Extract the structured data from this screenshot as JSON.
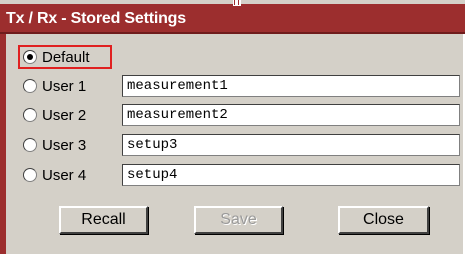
{
  "window": {
    "title": "Tx / Rx - Stored Settings"
  },
  "options": [
    {
      "label": "Default",
      "selected": true
    },
    {
      "label": "User 1",
      "selected": false,
      "value": "measurement1"
    },
    {
      "label": "User 2",
      "selected": false,
      "value": "measurement2"
    },
    {
      "label": "User 3",
      "selected": false,
      "value": "setup3"
    },
    {
      "label": "User 4",
      "selected": false,
      "value": "setup4"
    }
  ],
  "buttons": {
    "recall": {
      "label": "Recall",
      "enabled": true
    },
    "save": {
      "label": "Save",
      "enabled": false
    },
    "close": {
      "label": "Close",
      "enabled": true
    }
  },
  "colors": {
    "titlebar": "#9c2e2e",
    "panel": "#d4d0c8",
    "focus_outline": "#e02020"
  }
}
